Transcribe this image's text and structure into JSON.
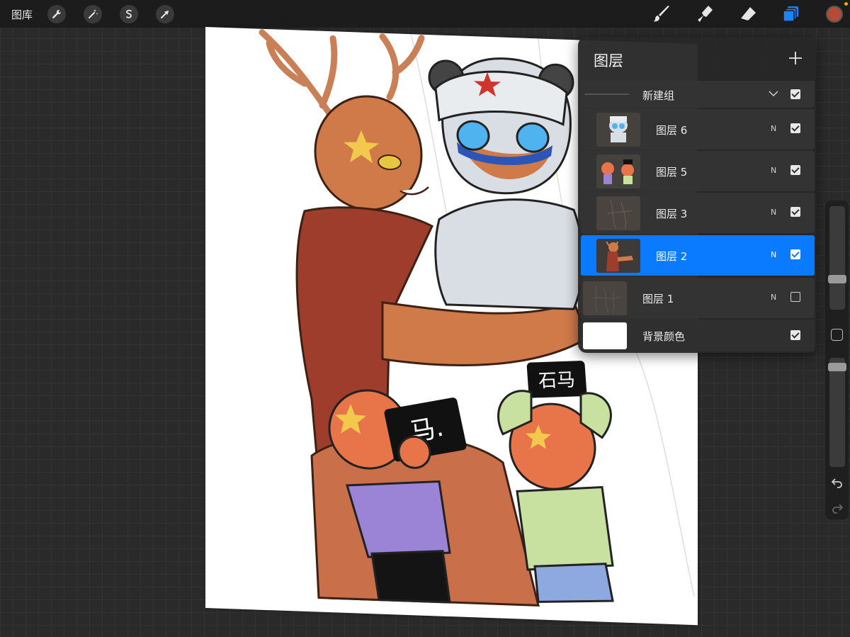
{
  "toolbar": {
    "gallery_label": "图库",
    "left_tools": [
      "wrench-icon",
      "magic-wand-icon",
      "selection-s-icon",
      "transform-arrow-icon"
    ],
    "right_tools": [
      "brush-icon",
      "smudge-icon",
      "eraser-icon",
      "layers-icon"
    ],
    "current_color": "#b54a38",
    "active_accent": "#1a84ff"
  },
  "layers_panel": {
    "title": "图层",
    "add_label": "+",
    "group": {
      "name": "新建组",
      "visible": true
    },
    "layers": [
      {
        "name": "图层 6",
        "mode": "N",
        "visible": true,
        "selected": false
      },
      {
        "name": "图层 5",
        "mode": "N",
        "visible": true,
        "selected": false
      },
      {
        "name": "图层 3",
        "mode": "N",
        "visible": true,
        "selected": false
      },
      {
        "name": "图层 2",
        "mode": "N",
        "visible": true,
        "selected": true
      },
      {
        "name": "图层 1",
        "mode": "N",
        "visible": false,
        "selected": false
      }
    ],
    "background": {
      "name": "背景颜色",
      "visible": true,
      "color": "#ffffff"
    }
  },
  "canvas_text": {
    "sign_left": "马.",
    "sign_right": "石马"
  }
}
